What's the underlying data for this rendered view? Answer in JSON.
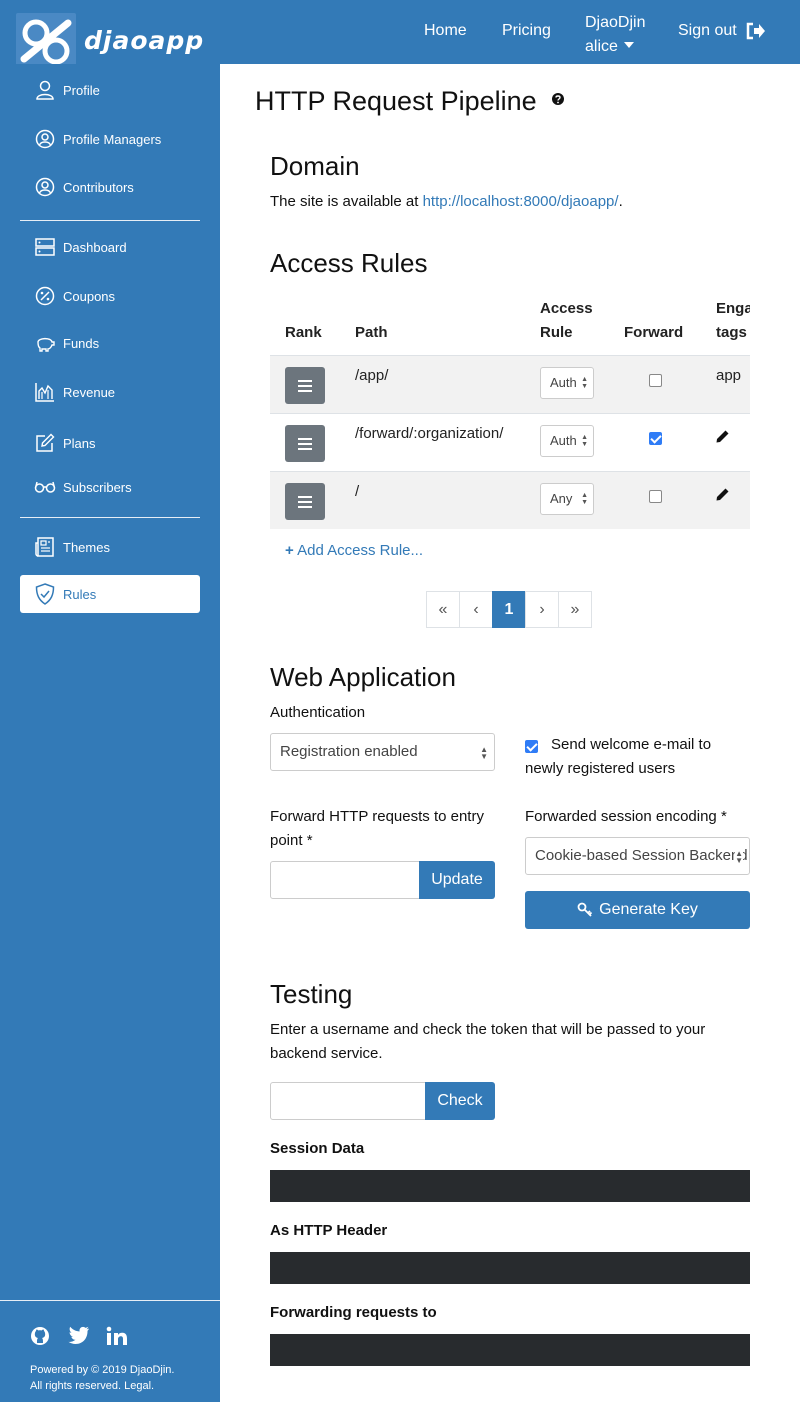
{
  "header": {
    "brand": "djaoapp",
    "nav": {
      "home": "Home",
      "pricing": "Pricing",
      "org": "DjaoDjin",
      "user": "alice",
      "signout": "Sign out"
    }
  },
  "sidebar": {
    "items": [
      {
        "label": "Profile",
        "icon": "user-icon"
      },
      {
        "label": "Profile Managers",
        "icon": "user-circle-icon"
      },
      {
        "label": "Contributors",
        "icon": "user-circle-icon"
      },
      {
        "label": "Dashboard",
        "icon": "server-icon"
      },
      {
        "label": "Coupons",
        "icon": "percent-icon"
      },
      {
        "label": "Funds",
        "icon": "piggy-bank-icon"
      },
      {
        "label": "Revenue",
        "icon": "chart-icon"
      },
      {
        "label": "Plans",
        "icon": "edit-icon"
      },
      {
        "label": "Subscribers",
        "icon": "glasses-icon"
      },
      {
        "label": "Themes",
        "icon": "newspaper-icon"
      },
      {
        "label": "Rules",
        "icon": "shield-icon"
      }
    ],
    "footer": {
      "line1": "Powered by © 2019 DjaoDjin.",
      "line2": "All rights reserved. Legal."
    }
  },
  "main": {
    "title": "HTTP Request Pipeline",
    "domain": {
      "heading": "Domain",
      "text_before": "The site is available at ",
      "url": "http://localhost:8000/djaoapp/",
      "text_after": "."
    },
    "access_rules": {
      "heading": "Access Rules",
      "columns": {
        "rank": "Rank",
        "path": "Path",
        "rule_1": "Access",
        "rule_2": "Rule",
        "forward": "Forward",
        "tags_1": "Enga",
        "tags_2": "tags"
      },
      "rows": [
        {
          "path": "/app/",
          "rule": "Auth",
          "forward": false,
          "tags": "app"
        },
        {
          "path": "/forward/:organization/",
          "rule": "Auth",
          "forward": true,
          "tags": ""
        },
        {
          "path": "/",
          "rule": "Any",
          "forward": false,
          "tags": ""
        }
      ],
      "add_label": "Add Access Rule...",
      "pagination": {
        "first": "«",
        "prev": "‹",
        "current": "1",
        "next": "›",
        "last": "»"
      }
    },
    "web_app": {
      "heading": "Web Application",
      "auth_label": "Authentication",
      "auth_value": "Registration enabled",
      "welcome_line1": "Send welcome e-mail to",
      "welcome_line2": "newly registered users",
      "forward_label_1": "Forward HTTP requests to entry",
      "forward_label_2": "point *",
      "update_label": "Update",
      "encoding_label": "Forwarded session encoding *",
      "encoding_value": "Cookie-based Session Backend",
      "generate_label": "Generate Key"
    },
    "testing": {
      "heading": "Testing",
      "desc_1": "Enter a username and check the token that will be passed to your",
      "desc_2": "backend service.",
      "check_label": "Check",
      "session_data": "Session Data",
      "as_header": "As HTTP Header",
      "forwarding": "Forwarding requests to"
    }
  }
}
